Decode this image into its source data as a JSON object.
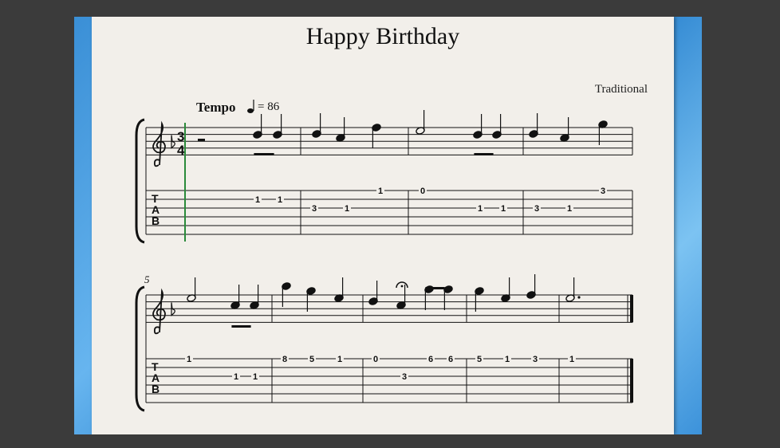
{
  "song": {
    "title": "Happy Birthday",
    "composer": "Traditional",
    "tempo_label": "Tempo",
    "tempo_value": "= 86",
    "time_signature": {
      "top": "3",
      "bottom": "4"
    },
    "tab_clef": [
      "T",
      "A",
      "B"
    ],
    "system2_measure_number": "5"
  },
  "tab": {
    "system1": [
      {
        "string": 2,
        "fret": "1"
      },
      {
        "string": 2,
        "fret": "1"
      },
      {
        "string": 3,
        "fret": "3"
      },
      {
        "string": 3,
        "fret": "1"
      },
      {
        "string": 1,
        "fret": "1"
      },
      {
        "string": 1,
        "fret": "0"
      },
      {
        "string": 3,
        "fret": "1"
      },
      {
        "string": 3,
        "fret": "1"
      },
      {
        "string": 3,
        "fret": "3"
      },
      {
        "string": 3,
        "fret": "1"
      },
      {
        "string": 1,
        "fret": "3"
      }
    ],
    "system2": [
      {
        "string": 1,
        "fret": "1"
      },
      {
        "string": 3,
        "fret": "1"
      },
      {
        "string": 3,
        "fret": "1"
      },
      {
        "string": 1,
        "fret": "8"
      },
      {
        "string": 1,
        "fret": "5"
      },
      {
        "string": 1,
        "fret": "1"
      },
      {
        "string": 1,
        "fret": "0"
      },
      {
        "string": 3,
        "fret": "3"
      },
      {
        "string": 1,
        "fret": "6"
      },
      {
        "string": 1,
        "fret": "6"
      },
      {
        "string": 1,
        "fret": "5"
      },
      {
        "string": 1,
        "fret": "1"
      },
      {
        "string": 1,
        "fret": "3"
      },
      {
        "string": 1,
        "fret": "1"
      }
    ]
  },
  "colors": {
    "paper": "#f2efea",
    "ink": "#111111",
    "cursor": "#2a8a3a",
    "background": "#3b3b3b",
    "desktop_blue": "#3a8fd6"
  }
}
